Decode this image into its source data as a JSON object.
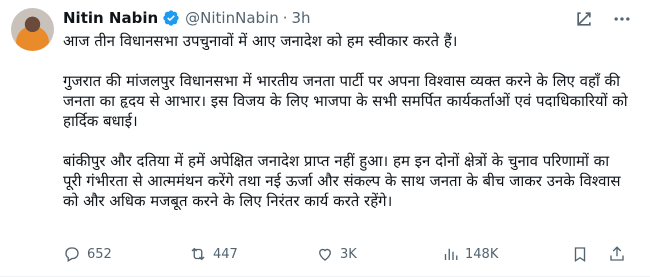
{
  "post": {
    "author_name": "Nitin Nabin",
    "handle": "@NitinNabin",
    "separator": "·",
    "time": "3h",
    "paragraphs": [
      "आज तीन विधानसभा उपचुनावों में आए जनादेश को हम स्वीकार करते हैं।",
      "गुजरात की मांजलपुर विधानसभा में भारतीय जनता पार्टी पर अपना विश्वास व्यक्त करने के लिए वहाँ की जनता का हृदय से आभार। इस विजय के लिए भाजपा के सभी समर्पित कार्यकर्ताओं एवं पदाधिकारियों को हार्दिक बधाई।",
      "बांकीपुर और दतिया में हमें अपेक्षित जनादेश प्राप्त नहीं हुआ। हम इन दोनों क्षेत्रों के चुनाव परिणामों का पूरी गंभीरता से आत्ममंथन करेंगे तथा नई ऊर्जा और संकल्प के साथ जनता के बीच जाकर उनके विश्वास को और अधिक मजबूत करने के लिए निरंतर कार्य करते रहेंगे।"
    ]
  },
  "actions": {
    "replies": "652",
    "reposts": "447",
    "likes": "3K",
    "views": "148K"
  },
  "icons": {
    "verified": "verified-badge-icon",
    "grok": "grok-icon",
    "more": "more-options-icon",
    "reply": "reply-icon",
    "repost": "repost-icon",
    "like": "heart-icon",
    "views": "views-bar-chart-icon",
    "bookmark": "bookmark-icon",
    "share": "share-icon"
  },
  "colors": {
    "verified": "#1d9bf0",
    "text": "#0f1419",
    "muted": "#536471"
  }
}
